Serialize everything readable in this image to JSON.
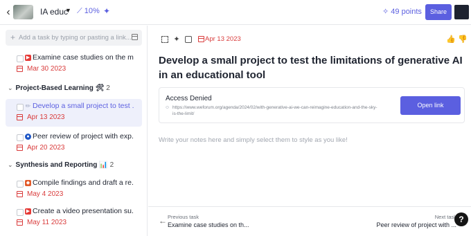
{
  "topbar": {
    "back_icon": "chevron-left",
    "course_title": "IA educ",
    "progress": "10%",
    "points": "49 points",
    "share_label": "Share"
  },
  "left": {
    "add_placeholder": "Add a task by typing or pasting a link...",
    "tasks_top": [
      {
        "title": "Examine case studies on the m...",
        "date": "Mar 30 2023",
        "icon": "youtube-icon"
      }
    ],
    "groups": [
      {
        "name": "Project-Based Learning",
        "emoji": "🛠",
        "count": "2",
        "tasks": [
          {
            "title": "Develop a small project to test ...",
            "date": "Apr 13 2023",
            "icon": "pencil-icon",
            "selected": true
          },
          {
            "title": "Peer review of project with exp...",
            "date": "Apr 20 2023",
            "icon": "globe-icon"
          }
        ]
      },
      {
        "name": "Synthesis and Reporting",
        "emoji": "📊",
        "count": "2",
        "tasks": [
          {
            "title": "Compile findings and draft a re...",
            "date": "May 4 2023",
            "icon": "gem-icon"
          },
          {
            "title": "Create a video presentation su...",
            "date": "May 11 2023",
            "icon": "youtube-icon"
          }
        ]
      }
    ]
  },
  "detail": {
    "date": "Apr 13 2023",
    "title": "Develop a small project to test the limitations of generative AI in an educational tool",
    "link_card": {
      "title": "Access Denied",
      "url": "https://www.weforum.org/agenda/2024/02/with-generative-ai-we-can-reimagine-education-and-the-sky-is-the-limit/",
      "button": "Open link"
    },
    "notes_placeholder": "Write your notes here and simply select them to style as you like!"
  },
  "footer": {
    "prev_label": "Previous task",
    "prev_title": "Examine case studies on th...",
    "next_label": "Next task",
    "next_title": "Peer review of project with ...",
    "help": "?"
  },
  "colors": {
    "accent": "#5b5fe0",
    "date_red": "#d93b3b",
    "selected_bg": "#eef0fb"
  }
}
